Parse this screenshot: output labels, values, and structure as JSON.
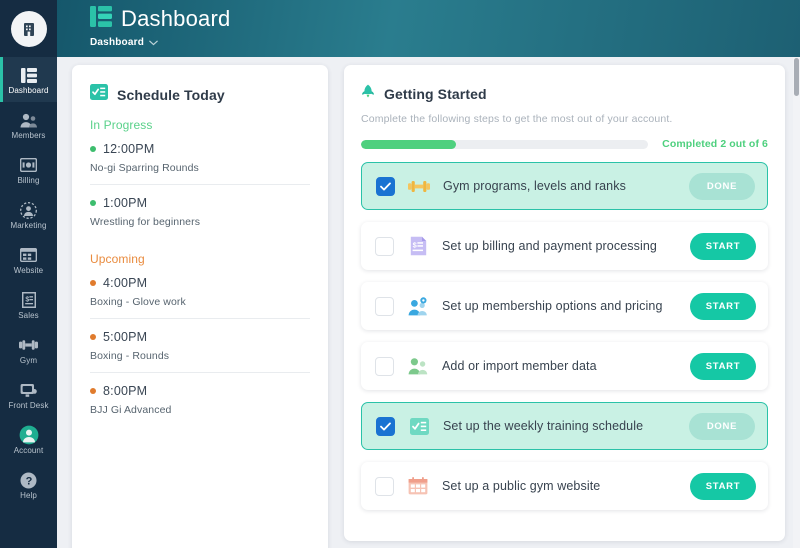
{
  "brand": {
    "accent_teal": "#15c8a5",
    "accent_green": "#4ed07e",
    "sidebar_bg": "#152c42",
    "header_gradient_from": "#15576b",
    "header_gradient_to": "#1d6073",
    "checkbox_blue": "#1a73d2"
  },
  "sidebar": {
    "logo_icon": "building-icon",
    "items": [
      {
        "label": "Dashboard",
        "icon": "dashboard-icon",
        "active": true
      },
      {
        "label": "Members",
        "icon": "members-icon",
        "active": false
      },
      {
        "label": "Billing",
        "icon": "billing-icon",
        "active": false
      },
      {
        "label": "Marketing",
        "icon": "marketing-icon",
        "active": false
      },
      {
        "label": "Website",
        "icon": "website-icon",
        "active": false
      },
      {
        "label": "Sales",
        "icon": "sales-icon",
        "active": false
      },
      {
        "label": "Gym",
        "icon": "dumbbell-icon",
        "active": false
      },
      {
        "label": "Front Desk",
        "icon": "monitor-icon",
        "active": false
      },
      {
        "label": "Account",
        "icon": "account-icon",
        "active": false
      },
      {
        "label": "Help",
        "icon": "help-icon",
        "active": false
      }
    ]
  },
  "header": {
    "title": "Dashboard",
    "title_icon": "dashboard-icon",
    "breadcrumb": "Dashboard",
    "breadcrumb_icon": "chevron-down-icon"
  },
  "schedule": {
    "title": "Schedule Today",
    "icon": "schedule-icon",
    "groups": [
      {
        "status": "In Progress",
        "status_color": "#5ad18a",
        "dot_color": "#3dbd6e",
        "items": [
          {
            "time": "12:00PM",
            "name": "No-gi Sparring Rounds"
          },
          {
            "time": "1:00PM",
            "name": "Wrestling for beginners"
          }
        ]
      },
      {
        "status": "Upcoming",
        "status_color": "#e98b3e",
        "dot_color": "#e07b2d",
        "items": [
          {
            "time": "4:00PM",
            "name": "Boxing - Glove work"
          },
          {
            "time": "5:00PM",
            "name": "Boxing - Rounds"
          },
          {
            "time": "8:00PM",
            "name": "BJJ Gi Advanced"
          }
        ]
      }
    ]
  },
  "getting_started": {
    "title": "Getting Started",
    "icon": "rocket-icon",
    "subtitle": "Complete the following steps to get the most out of your account.",
    "progress_label": "Completed 2 out of 6",
    "progress_percent": 33,
    "completed_count": 2,
    "total_count": 6,
    "tasks": [
      {
        "label": "Gym programs, levels and ranks",
        "icon": "dumbbell-icon",
        "done": true,
        "action": "DONE"
      },
      {
        "label": "Set up billing and payment processing",
        "icon": "invoice-icon",
        "done": false,
        "action": "START"
      },
      {
        "label": "Set up membership options and pricing",
        "icon": "members-gear-icon",
        "done": false,
        "action": "START"
      },
      {
        "label": "Add or import member data",
        "icon": "members-icon",
        "done": false,
        "action": "START"
      },
      {
        "label": "Set up the weekly training schedule",
        "icon": "schedule-icon",
        "done": true,
        "action": "DONE"
      },
      {
        "label": "Set up a public gym website",
        "icon": "calendar-icon",
        "done": false,
        "action": "START"
      }
    ]
  }
}
